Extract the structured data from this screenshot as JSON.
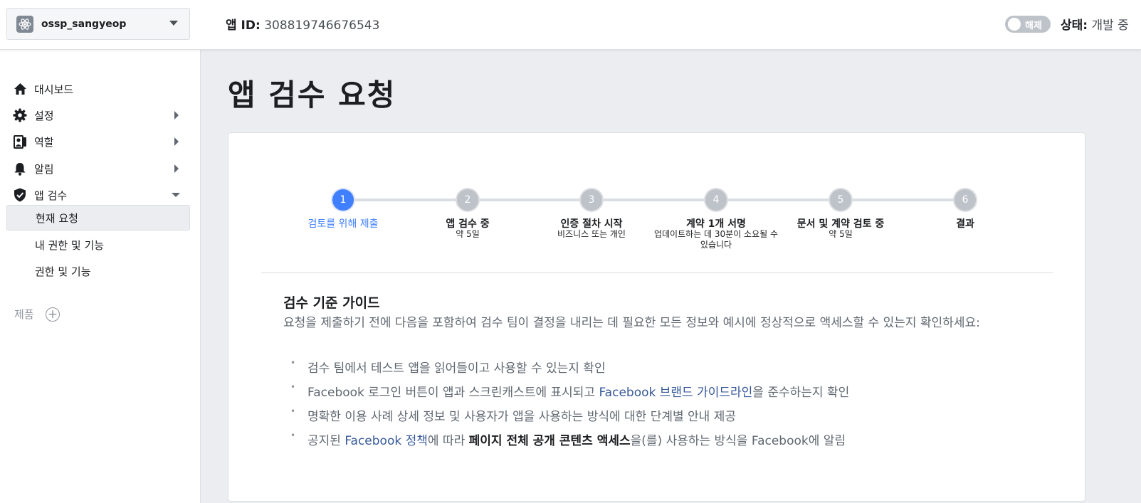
{
  "header": {
    "app_name": "ossp_sangyeop",
    "app_id_label": "앱 ID:",
    "app_id": "308819746676543",
    "toggle_label": "해제",
    "status_label": "상태:",
    "status_value": "개발 중"
  },
  "sidebar": {
    "items": [
      {
        "label": "대시보드",
        "icon": "home-icon"
      },
      {
        "label": "설정",
        "icon": "gear-icon"
      },
      {
        "label": "역할",
        "icon": "roles-icon"
      },
      {
        "label": "알림",
        "icon": "bell-icon"
      },
      {
        "label": "앱 검수",
        "icon": "shield-check-icon"
      }
    ],
    "sub_items": [
      {
        "label": "현재 요청",
        "active": true
      },
      {
        "label": "내 권한 및 기능"
      },
      {
        "label": "권한 및 기능"
      }
    ],
    "products_label": "제품"
  },
  "main": {
    "title": "앱 검수 요청",
    "steps": [
      {
        "number": "1",
        "title": "검토를 위해 제출",
        "sub": ""
      },
      {
        "number": "2",
        "title": "앱 검수 중",
        "sub": "약 5일"
      },
      {
        "number": "3",
        "title": "인증 절차 시작",
        "sub": "비즈니스 또는 개인"
      },
      {
        "number": "4",
        "title": "계약 1개 서명",
        "sub": "업데이트하는 데 30분이 소요될 수 있습니다"
      },
      {
        "number": "5",
        "title": "문서 및 계약 검토 중",
        "sub": "약 5일"
      },
      {
        "number": "6",
        "title": "결과",
        "sub": ""
      }
    ],
    "guide_title": "검수 기준 가이드",
    "guide_desc": "요청을 제출하기 전에 다음을 포함하여 검수 팀이 결정을 내리는 데 필요한 모든 정보와 예시에 정상적으로 액세스할 수 있는지 확인하세요:",
    "bullets": {
      "b1": "검수 팀에서 테스트 앱을 읽어들이고 사용할 수 있는지 확인",
      "b2_pre": "Facebook 로그인 버튼이 앱과 스크린캐스트에 표시되고 ",
      "b2_link": "Facebook 브랜드 가이드라인",
      "b2_post": "을 준수하는지 확인",
      "b3": "명확한 이용 사례 상세 정보 및 사용자가 앱을 사용하는 방식에 대한 단계별 안내 제공",
      "b4_pre": "공지된 ",
      "b4_link": "Facebook 정책",
      "b4_mid": "에 따라 ",
      "b4_strong": "페이지 전체 공개 콘텐츠 액세스",
      "b4_post": "을(를) 사용하는 방식을 Facebook에 알림"
    }
  },
  "colors": {
    "accent": "#4080ff",
    "link": "#365899",
    "background": "#ebedf0"
  }
}
